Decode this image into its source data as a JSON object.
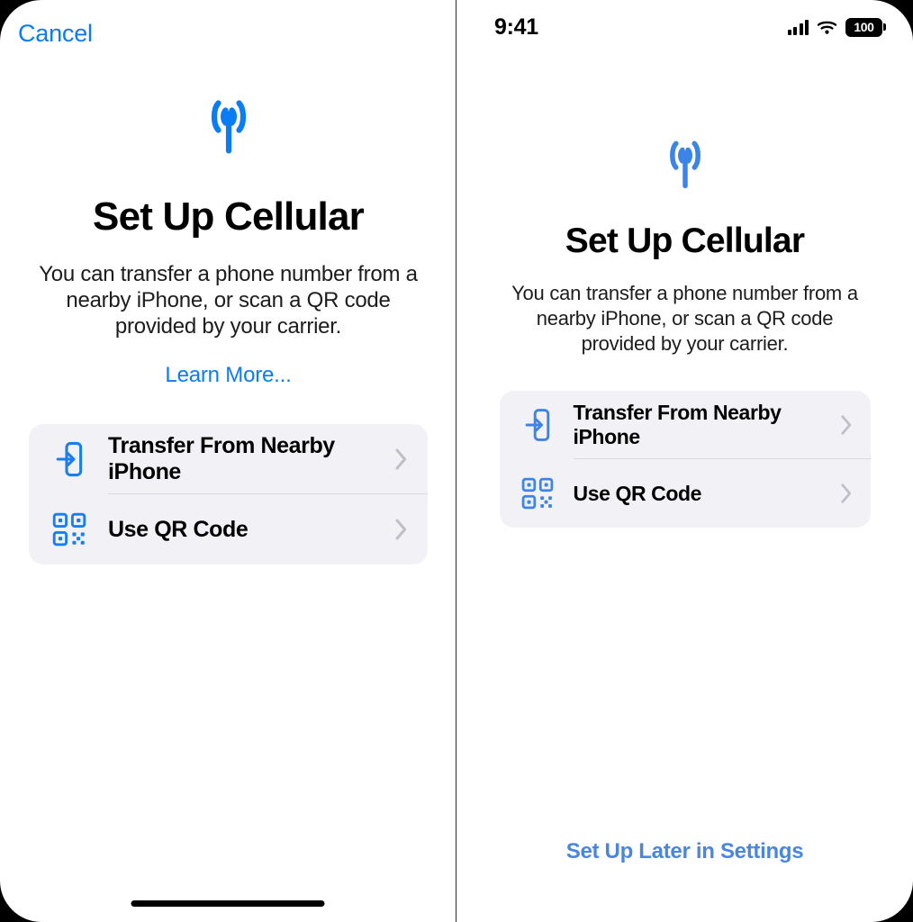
{
  "accent_blue": "#0a7cf4",
  "icon_blue": "#2f7ae5",
  "card_background": "#f1f1f6",
  "later_link_blue": "#4a86e0",
  "left_screen": {
    "cancel_label": "Cancel",
    "hero_icon": "cellular-antenna-icon",
    "title": "Set Up Cellular",
    "subtitle": "You can transfer a phone number from a nearby iPhone, or scan a QR code provided by your carrier.",
    "learn_more_label": "Learn More...",
    "options": [
      {
        "icon": "transfer-into-phone-icon",
        "label": "Transfer From Nearby iPhone",
        "accessory": "chevron-right-icon"
      },
      {
        "icon": "qr-code-icon",
        "label": "Use QR Code",
        "accessory": "chevron-right-icon"
      }
    ],
    "home_indicator": "home-indicator"
  },
  "right_screen": {
    "status_bar": {
      "time": "9:41",
      "cellular_icon": "cellular-signal-icon",
      "wifi_icon": "wifi-icon",
      "battery_icon": "battery-icon",
      "battery_level": "100"
    },
    "hero_icon": "cellular-antenna-icon",
    "title": "Set Up Cellular",
    "subtitle": "You can transfer a phone number from a nearby iPhone, or scan a QR code provided by your carrier.",
    "options": [
      {
        "icon": "transfer-into-phone-icon",
        "label": "Transfer From Nearby iPhone",
        "accessory": "chevron-right-icon"
      },
      {
        "icon": "qr-code-icon",
        "label": "Use QR Code",
        "accessory": "chevron-right-icon"
      }
    ],
    "later_label": "Set Up Later in Settings"
  }
}
